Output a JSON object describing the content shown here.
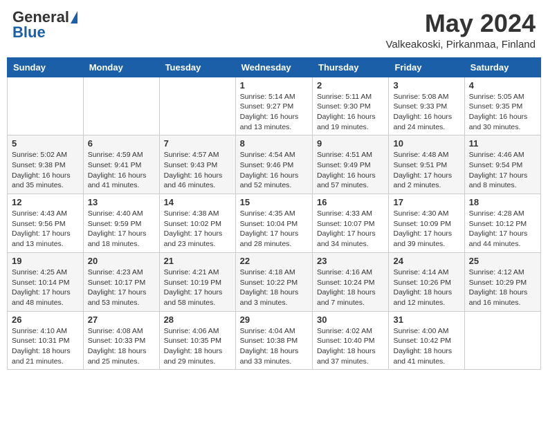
{
  "header": {
    "logo_general": "General",
    "logo_blue": "Blue",
    "month_title": "May 2024",
    "location": "Valkeakoski, Pirkanmaa, Finland"
  },
  "days_of_week": [
    "Sunday",
    "Monday",
    "Tuesday",
    "Wednesday",
    "Thursday",
    "Friday",
    "Saturday"
  ],
  "weeks": [
    [
      {
        "day": "",
        "info": ""
      },
      {
        "day": "",
        "info": ""
      },
      {
        "day": "",
        "info": ""
      },
      {
        "day": "1",
        "info": "Sunrise: 5:14 AM\nSunset: 9:27 PM\nDaylight: 16 hours\nand 13 minutes."
      },
      {
        "day": "2",
        "info": "Sunrise: 5:11 AM\nSunset: 9:30 PM\nDaylight: 16 hours\nand 19 minutes."
      },
      {
        "day": "3",
        "info": "Sunrise: 5:08 AM\nSunset: 9:33 PM\nDaylight: 16 hours\nand 24 minutes."
      },
      {
        "day": "4",
        "info": "Sunrise: 5:05 AM\nSunset: 9:35 PM\nDaylight: 16 hours\nand 30 minutes."
      }
    ],
    [
      {
        "day": "5",
        "info": "Sunrise: 5:02 AM\nSunset: 9:38 PM\nDaylight: 16 hours\nand 35 minutes."
      },
      {
        "day": "6",
        "info": "Sunrise: 4:59 AM\nSunset: 9:41 PM\nDaylight: 16 hours\nand 41 minutes."
      },
      {
        "day": "7",
        "info": "Sunrise: 4:57 AM\nSunset: 9:43 PM\nDaylight: 16 hours\nand 46 minutes."
      },
      {
        "day": "8",
        "info": "Sunrise: 4:54 AM\nSunset: 9:46 PM\nDaylight: 16 hours\nand 52 minutes."
      },
      {
        "day": "9",
        "info": "Sunrise: 4:51 AM\nSunset: 9:49 PM\nDaylight: 16 hours\nand 57 minutes."
      },
      {
        "day": "10",
        "info": "Sunrise: 4:48 AM\nSunset: 9:51 PM\nDaylight: 17 hours\nand 2 minutes."
      },
      {
        "day": "11",
        "info": "Sunrise: 4:46 AM\nSunset: 9:54 PM\nDaylight: 17 hours\nand 8 minutes."
      }
    ],
    [
      {
        "day": "12",
        "info": "Sunrise: 4:43 AM\nSunset: 9:56 PM\nDaylight: 17 hours\nand 13 minutes."
      },
      {
        "day": "13",
        "info": "Sunrise: 4:40 AM\nSunset: 9:59 PM\nDaylight: 17 hours\nand 18 minutes."
      },
      {
        "day": "14",
        "info": "Sunrise: 4:38 AM\nSunset: 10:02 PM\nDaylight: 17 hours\nand 23 minutes."
      },
      {
        "day": "15",
        "info": "Sunrise: 4:35 AM\nSunset: 10:04 PM\nDaylight: 17 hours\nand 28 minutes."
      },
      {
        "day": "16",
        "info": "Sunrise: 4:33 AM\nSunset: 10:07 PM\nDaylight: 17 hours\nand 34 minutes."
      },
      {
        "day": "17",
        "info": "Sunrise: 4:30 AM\nSunset: 10:09 PM\nDaylight: 17 hours\nand 39 minutes."
      },
      {
        "day": "18",
        "info": "Sunrise: 4:28 AM\nSunset: 10:12 PM\nDaylight: 17 hours\nand 44 minutes."
      }
    ],
    [
      {
        "day": "19",
        "info": "Sunrise: 4:25 AM\nSunset: 10:14 PM\nDaylight: 17 hours\nand 48 minutes."
      },
      {
        "day": "20",
        "info": "Sunrise: 4:23 AM\nSunset: 10:17 PM\nDaylight: 17 hours\nand 53 minutes."
      },
      {
        "day": "21",
        "info": "Sunrise: 4:21 AM\nSunset: 10:19 PM\nDaylight: 17 hours\nand 58 minutes."
      },
      {
        "day": "22",
        "info": "Sunrise: 4:18 AM\nSunset: 10:22 PM\nDaylight: 18 hours\nand 3 minutes."
      },
      {
        "day": "23",
        "info": "Sunrise: 4:16 AM\nSunset: 10:24 PM\nDaylight: 18 hours\nand 7 minutes."
      },
      {
        "day": "24",
        "info": "Sunrise: 4:14 AM\nSunset: 10:26 PM\nDaylight: 18 hours\nand 12 minutes."
      },
      {
        "day": "25",
        "info": "Sunrise: 4:12 AM\nSunset: 10:29 PM\nDaylight: 18 hours\nand 16 minutes."
      }
    ],
    [
      {
        "day": "26",
        "info": "Sunrise: 4:10 AM\nSunset: 10:31 PM\nDaylight: 18 hours\nand 21 minutes."
      },
      {
        "day": "27",
        "info": "Sunrise: 4:08 AM\nSunset: 10:33 PM\nDaylight: 18 hours\nand 25 minutes."
      },
      {
        "day": "28",
        "info": "Sunrise: 4:06 AM\nSunset: 10:35 PM\nDaylight: 18 hours\nand 29 minutes."
      },
      {
        "day": "29",
        "info": "Sunrise: 4:04 AM\nSunset: 10:38 PM\nDaylight: 18 hours\nand 33 minutes."
      },
      {
        "day": "30",
        "info": "Sunrise: 4:02 AM\nSunset: 10:40 PM\nDaylight: 18 hours\nand 37 minutes."
      },
      {
        "day": "31",
        "info": "Sunrise: 4:00 AM\nSunset: 10:42 PM\nDaylight: 18 hours\nand 41 minutes."
      },
      {
        "day": "",
        "info": ""
      }
    ]
  ]
}
